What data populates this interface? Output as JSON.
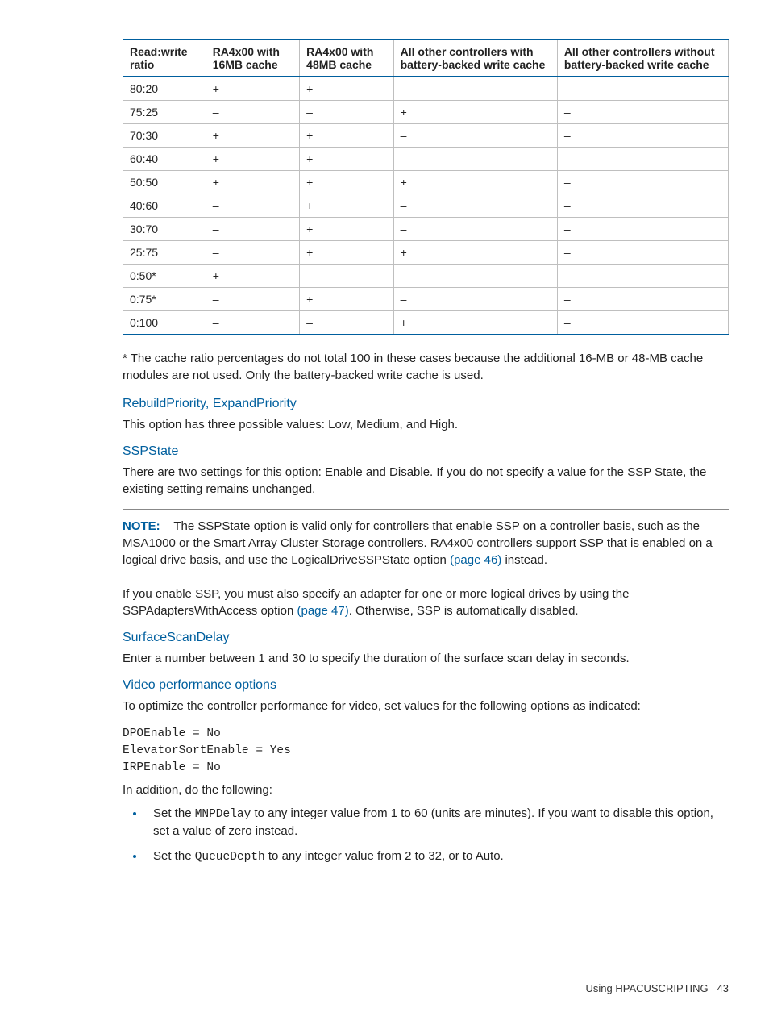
{
  "table": {
    "headers": [
      "Read:write ratio",
      "RA4x00 with 16MB cache",
      "RA4x00 with 48MB cache",
      "All other controllers with battery-backed write cache",
      "All other controllers without battery-backed write cache"
    ],
    "rows": [
      [
        "80:20",
        "+",
        "+",
        "–",
        "–"
      ],
      [
        "75:25",
        "–",
        "–",
        "+",
        "–"
      ],
      [
        "70:30",
        "+",
        "+",
        "–",
        "–"
      ],
      [
        "60:40",
        "+",
        "+",
        "–",
        "–"
      ],
      [
        "50:50",
        "+",
        "+",
        "+",
        "–"
      ],
      [
        "40:60",
        "–",
        "+",
        "–",
        "–"
      ],
      [
        "30:70",
        "–",
        "+",
        "–",
        "–"
      ],
      [
        "25:75",
        "–",
        "+",
        "+",
        "–"
      ],
      [
        "0:50*",
        "+",
        "–",
        "–",
        "–"
      ],
      [
        "0:75*",
        "–",
        "+",
        "–",
        "–"
      ],
      [
        "0:100",
        "–",
        "–",
        "+",
        "–"
      ]
    ]
  },
  "footnote": "* The cache ratio percentages do not total 100 in these cases because the additional 16-MB or 48-MB cache modules are not used. Only the battery-backed write cache is used.",
  "sections": {
    "rebuild": {
      "heading": "RebuildPriority, ExpandPriority",
      "body": "This option has three possible values: Low, Medium, and High."
    },
    "ssp": {
      "heading": "SSPState",
      "body1": "There are two settings for this option: Enable and Disable. If you do not specify a value for the SSP State, the existing setting remains unchanged.",
      "note_label": "NOTE:",
      "note_body_pre": "The SSPState option is valid only for controllers that enable SSP on a controller basis, such as the MSA1000 or the Smart Array Cluster Storage controllers. RA4x00 controllers support SSP that is enabled on a logical drive basis, and use the LogicalDriveSSPState option ",
      "note_link1": "(page 46)",
      "note_body_post": " instead.",
      "body2_pre": "If you enable SSP, you must also specify an adapter for one or more logical drives by using the SSPAdaptersWithAccess option ",
      "body2_link": "(page 47)",
      "body2_post": ". Otherwise, SSP is automatically disabled."
    },
    "scan": {
      "heading": "SurfaceScanDelay",
      "body": "Enter a number between 1 and 30 to specify the duration of the surface scan delay in seconds."
    },
    "video": {
      "heading": "Video performance options",
      "intro": "To optimize the controller performance for video, set values for the following options as indicated:",
      "code": "DPOEnable = No\nElevatorSortEnable = Yes\nIRPEnable = No",
      "addition": "In addition, do the following:",
      "bullets": [
        {
          "pre": "Set the ",
          "code": "MNPDelay",
          "post": " to any integer value from 1 to 60 (units are minutes). If you want to disable this option, set a value of zero instead."
        },
        {
          "pre": "Set the ",
          "code": "QueueDepth",
          "post": " to any integer value from 2 to 32, or to Auto."
        }
      ]
    }
  },
  "footer": {
    "label": "Using HPACUSCRIPTING",
    "page": "43"
  }
}
